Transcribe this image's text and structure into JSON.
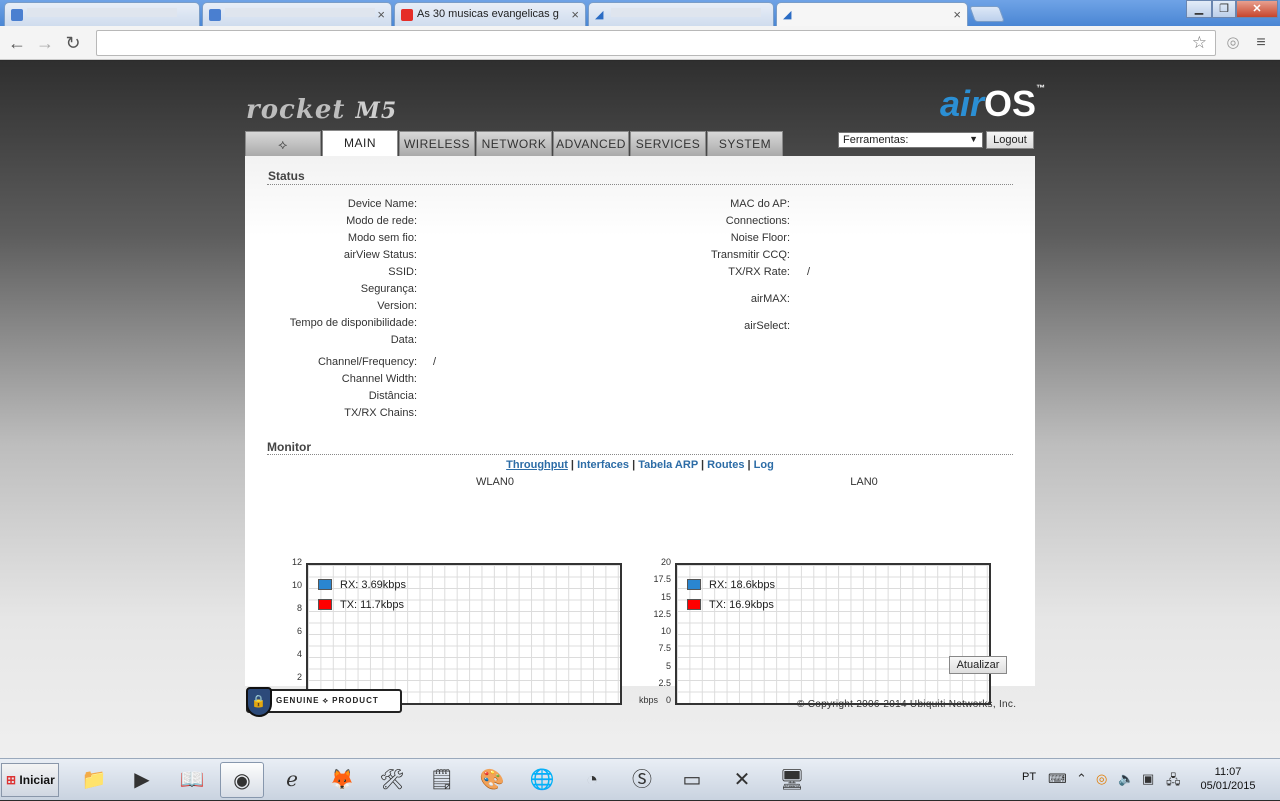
{
  "browser": {
    "tabs": [
      {
        "title": "",
        "favicon": "blue-doc-icon"
      },
      {
        "title": "",
        "favicon": "blue-doc-icon"
      },
      {
        "title": "As 30 musicas evangelicas g",
        "favicon": "youtube-icon"
      },
      {
        "title": "",
        "favicon": "rss-icon"
      },
      {
        "title": "",
        "favicon": "rss-icon"
      }
    ],
    "window_controls": {
      "minimize": "▁",
      "restore": "❐",
      "close": "✕"
    },
    "address": "",
    "colors": {
      "tabstrip": "#4a86d4",
      "youtube": "#e52d27"
    }
  },
  "header": {
    "product": "rocket",
    "model": "M5",
    "os_air": "air",
    "os_os": "OS",
    "tm": "™"
  },
  "nav": {
    "tabs": [
      "MAIN",
      "WIRELESS",
      "NETWORK",
      "ADVANCED",
      "SERVICES",
      "SYSTEM"
    ],
    "active": "MAIN",
    "logo_glyph": "⟡"
  },
  "tools": {
    "label": "Ferramentas:",
    "arrow": "▼",
    "logout": "Logout"
  },
  "status": {
    "title": "Status",
    "left": [
      {
        "label": "Device Name:",
        "value": ""
      },
      {
        "label": "Modo de rede:",
        "value": ""
      },
      {
        "label": "Modo sem fio:",
        "value": ""
      },
      {
        "label": "airView Status:",
        "value": ""
      },
      {
        "label": "SSID:",
        "value": ""
      },
      {
        "label": "Segurança:",
        "value": ""
      },
      {
        "label": "Version:",
        "value": ""
      },
      {
        "label": "Tempo de disponibilidade:",
        "value": ""
      },
      {
        "label": "Data:",
        "value": ""
      }
    ],
    "left2": [
      {
        "label": "Channel/Frequency:",
        "value": "/"
      },
      {
        "label": "Channel Width:",
        "value": ""
      },
      {
        "label": "Distância:",
        "value": ""
      },
      {
        "label": "TX/RX Chains:",
        "value": ""
      }
    ],
    "right": [
      {
        "label": "MAC do AP:",
        "value": ""
      },
      {
        "label": "Connections:",
        "value": ""
      },
      {
        "label": "Noise Floor:",
        "value": ""
      },
      {
        "label": "Transmitir CCQ:",
        "value": ""
      },
      {
        "label": "TX/RX Rate:",
        "value": "/"
      },
      {
        "label": "airMAX:",
        "value": ""
      },
      {
        "label": "airSelect:",
        "value": ""
      }
    ]
  },
  "monitor": {
    "title": "Monitor",
    "links": [
      "Throughput",
      "Interfaces",
      "Tabela ARP",
      "Routes",
      "Log"
    ],
    "active_link": "Throughput",
    "refresh": "Atualizar"
  },
  "chart_data": [
    {
      "type": "line",
      "title": "WLAN0",
      "ylabel": "kbps",
      "yticks": [
        "0",
        "2",
        "4",
        "6",
        "8",
        "10",
        "12"
      ],
      "ylim": [
        0,
        12
      ],
      "grid": true,
      "legend_placement": "top-left",
      "series": [
        {
          "name": "RX: 3.69kbps",
          "color": "#2a86d0",
          "values": []
        },
        {
          "name": "TX: 11.7kbps",
          "color": "#ff0000",
          "values": []
        }
      ]
    },
    {
      "type": "line",
      "title": "LAN0",
      "ylabel": "kbps",
      "yticks": [
        "0",
        "2.5",
        "5",
        "7.5",
        "10",
        "12.5",
        "15",
        "17.5",
        "20"
      ],
      "ylim": [
        0,
        20
      ],
      "grid": true,
      "legend_placement": "top-left",
      "series": [
        {
          "name": "RX: 18.6kbps",
          "color": "#2a86d0",
          "values": []
        },
        {
          "name": "TX: 16.9kbps",
          "color": "#ff0000",
          "values": []
        }
      ]
    }
  ],
  "footer": {
    "genuine": "GENUINE ⟡ PRODUCT",
    "lock": "🔒",
    "copyright": "© Copyright 2006-2014 Ubiquiti Networks, Inc."
  },
  "taskbar": {
    "start": "Iniciar",
    "start_flag": "⊞",
    "apps": [
      {
        "name": "explorer-icon",
        "glyph": "📁"
      },
      {
        "name": "media-player-icon",
        "glyph": "▶"
      },
      {
        "name": "book-icon",
        "glyph": "📖"
      },
      {
        "name": "chrome-icon",
        "glyph": "◉"
      },
      {
        "name": "ie-icon",
        "glyph": "ℯ"
      },
      {
        "name": "firefox-icon",
        "glyph": "🦊"
      },
      {
        "name": "tool-icon",
        "glyph": "🛠"
      },
      {
        "name": "notes-icon",
        "glyph": "🗒"
      },
      {
        "name": "paint-icon",
        "glyph": "🎨"
      },
      {
        "name": "earth-icon",
        "glyph": "🌐"
      },
      {
        "name": "radar-icon",
        "glyph": "◔"
      },
      {
        "name": "skype-icon",
        "glyph": "Ⓢ"
      },
      {
        "name": "cmd-icon",
        "glyph": "▭"
      },
      {
        "name": "x-app-icon",
        "glyph": "✕"
      },
      {
        "name": "network-app-icon",
        "glyph": "🖥"
      }
    ],
    "tray": {
      "lang": "PT",
      "keyboard": "⌨",
      "chevron": "⌃",
      "avast": "◎",
      "volume": "🔈",
      "device": "▣",
      "network": "🖧",
      "time": "11:07",
      "date": "05/01/2015"
    }
  }
}
